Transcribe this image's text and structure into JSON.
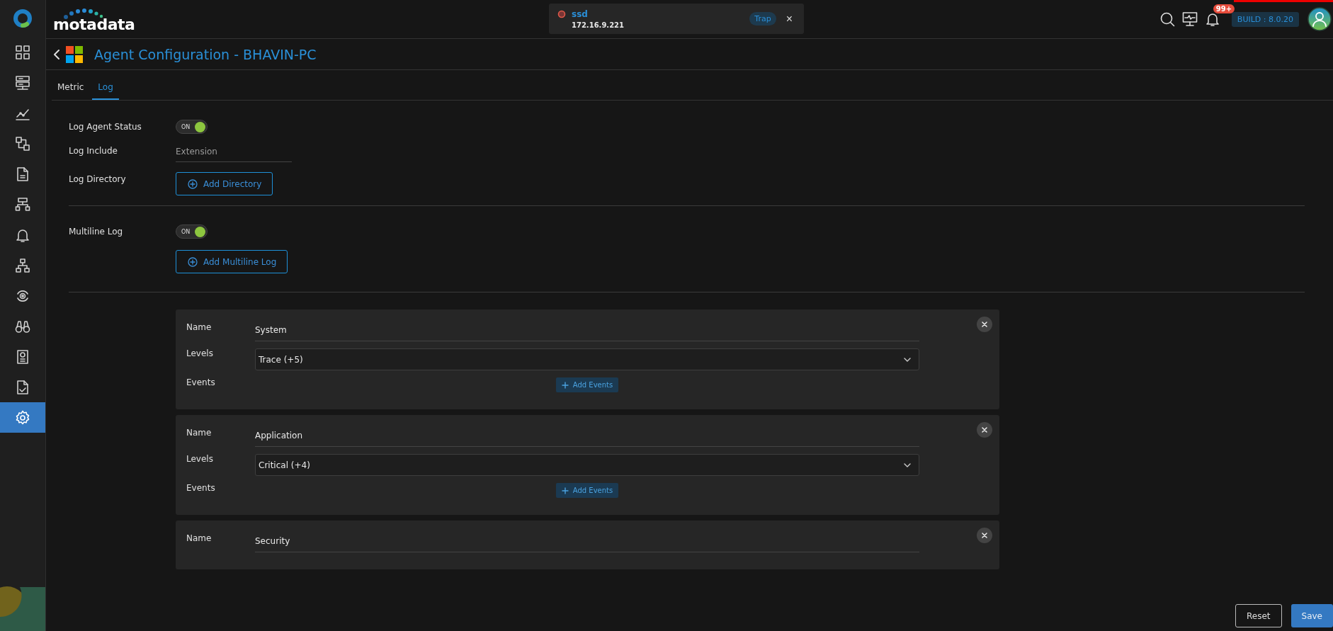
{
  "sidebar": {
    "items": [
      {
        "kind": "grid",
        "selected": false
      },
      {
        "kind": "servers",
        "selected": false
      },
      {
        "kind": "chart",
        "selected": false
      },
      {
        "kind": "flow",
        "selected": false
      },
      {
        "kind": "document",
        "selected": false
      },
      {
        "kind": "network",
        "selected": false
      },
      {
        "kind": "bell",
        "selected": false
      },
      {
        "kind": "hierarchy",
        "selected": false
      },
      {
        "kind": "cycle",
        "selected": false
      },
      {
        "kind": "binoculars",
        "selected": false
      },
      {
        "kind": "report",
        "selected": false
      },
      {
        "kind": "checklist",
        "selected": false
      },
      {
        "kind": "settings",
        "selected": true
      }
    ]
  },
  "header": {
    "logo": "motadata",
    "notification": {
      "title": "ssd",
      "address": "172.16.9.221",
      "tag": "Trap",
      "close": "×"
    },
    "alerts_badge": "99+",
    "build": "BUILD : 8.0.20"
  },
  "page": {
    "title": "Agent Configuration - BHAVIN-PC"
  },
  "tabs": [
    {
      "label": "Metric",
      "selected": false
    },
    {
      "label": "Log",
      "selected": true
    }
  ],
  "form": {
    "log_agent_status": {
      "label": "Log Agent Status",
      "on": true,
      "toggle_text": "ON"
    },
    "log_include": {
      "label": "Log Include",
      "placeholder": "Extension"
    },
    "log_directory": {
      "label": "Log Directory",
      "button": "Add Directory"
    },
    "multiline_log": {
      "label": "Multiline Log",
      "on": true,
      "toggle_text": "ON",
      "button": "Add Multiline Log"
    }
  },
  "log_sources": [
    {
      "name_label": "Name",
      "name": "System",
      "levels_label": "Levels",
      "levels": "Trace (+5)",
      "events_label": "Events",
      "add_events": "Add Events"
    },
    {
      "name_label": "Name",
      "name": "Application",
      "levels_label": "Levels",
      "levels": "Critical (+4)",
      "events_label": "Events",
      "add_events": "Add Events"
    },
    {
      "name_label": "Name",
      "name": "Security"
    }
  ],
  "buttons": [
    {
      "label": "Reset",
      "kind": "secondary"
    },
    {
      "label": "Save",
      "kind": "primary"
    }
  ]
}
